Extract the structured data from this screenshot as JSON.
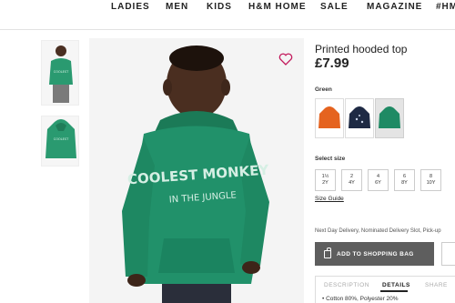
{
  "nav": {
    "items": [
      "LADIES",
      "MEN",
      "KIDS",
      "H&M HOME",
      "SALE",
      "MAGAZINE",
      "#HM"
    ]
  },
  "product": {
    "title": "Printed hooded top",
    "price": "£7.99",
    "print_text_line1": "COOLEST MONKEY",
    "print_text_line2": "IN THE JUNGLE",
    "main_color": "#1f8a64"
  },
  "color_selector": {
    "label": "Green",
    "swatches": [
      {
        "name": "orange",
        "color": "#e5631f"
      },
      {
        "name": "navy",
        "color": "#1e2a44"
      },
      {
        "name": "green",
        "color": "#1f8a64",
        "selected": true
      }
    ]
  },
  "size_selector": {
    "label": "Select size",
    "sizes": [
      {
        "line1": "1½",
        "line2": "2Y"
      },
      {
        "line1": "2",
        "line2": "4Y"
      },
      {
        "line1": "4",
        "line2": "6Y"
      },
      {
        "line1": "6",
        "line2": "8Y"
      },
      {
        "line1": "8",
        "line2": "10Y"
      }
    ],
    "guide_link": "Size Guide"
  },
  "delivery": "Next Day Delivery, Nominated Delivery Slot, Pick-up",
  "actions": {
    "add_to_bag": "ADD TO SHOPPING BAG"
  },
  "tabs": {
    "description": "DESCRIPTION",
    "details": "DETAILS",
    "share": "SHARE"
  },
  "details_first_line": "• Cotton 80%, Polyester 20%"
}
